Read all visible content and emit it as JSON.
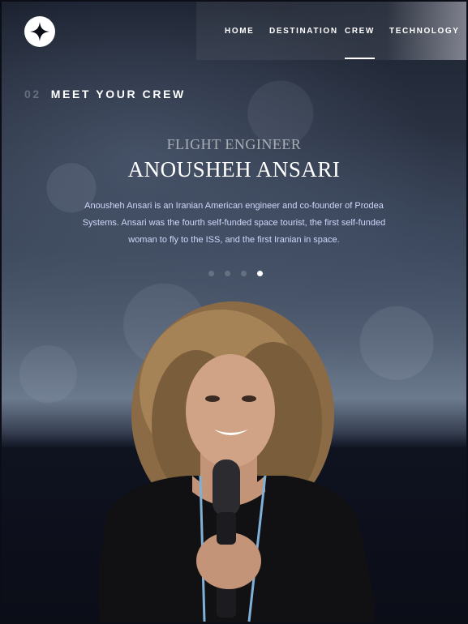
{
  "nav": {
    "items": [
      {
        "label": "HOME"
      },
      {
        "label": "DESTINATION"
      },
      {
        "label": "CREW",
        "active": true
      },
      {
        "label": "TECHNOLOGY"
      }
    ]
  },
  "section": {
    "number": "02",
    "title": "MEET YOUR CREW"
  },
  "crew": {
    "role": "FLIGHT ENGINEER",
    "name": "ANOUSHEH ANSARI",
    "bio_lines": [
      "Anousheh Ansari is an Iranian American engineer and co-founder of Prodea",
      "Systems. Ansari was the fourth self-funded space tourist, the first self-funded",
      "woman to fly to the ISS, and the first Iranian in space."
    ]
  },
  "pagination": {
    "total": 4,
    "active_index": 3
  },
  "colors": {
    "background": "#0b0d17",
    "text": "#ffffff",
    "body_text": "#d0d6f9"
  }
}
